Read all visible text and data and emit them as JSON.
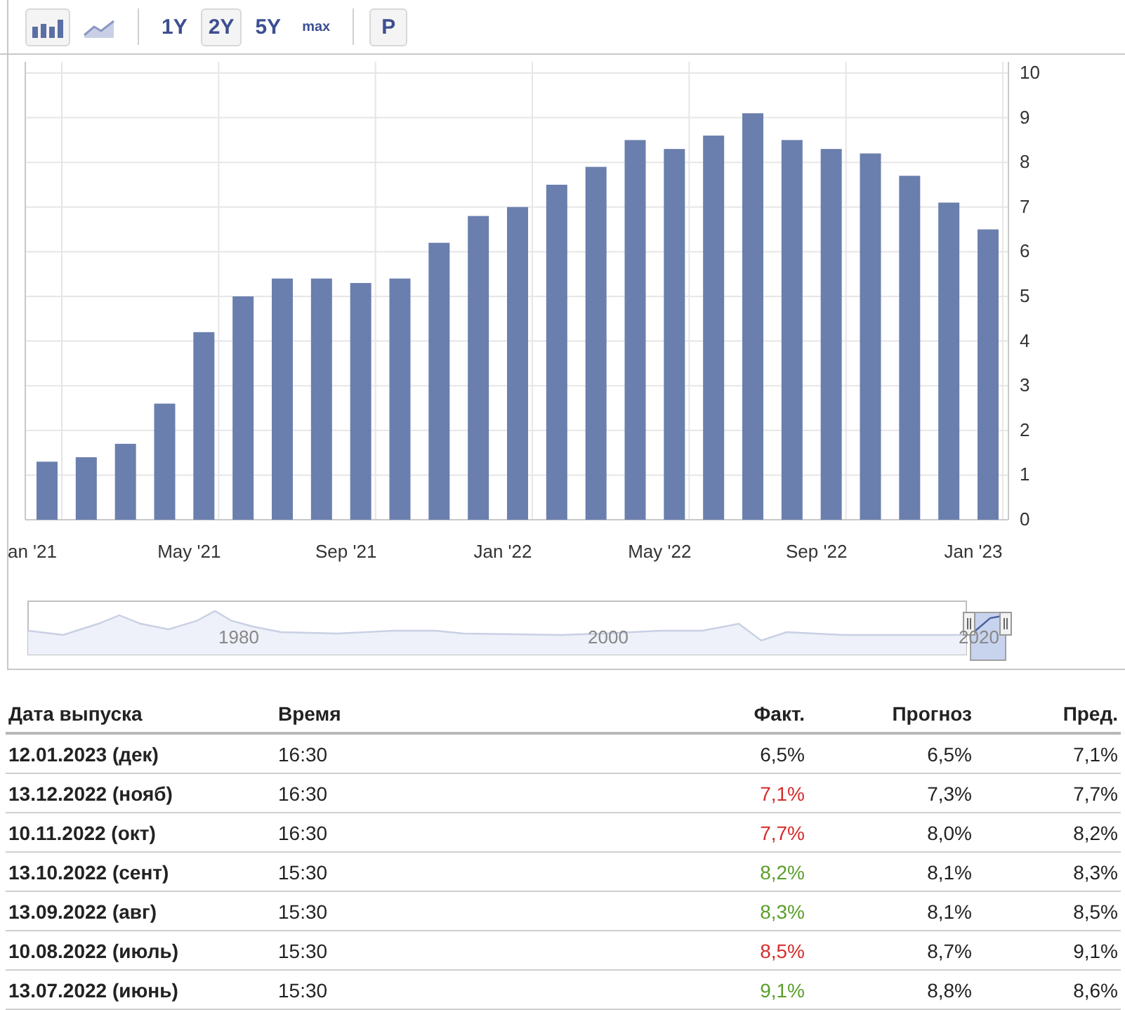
{
  "toolbar": {
    "chart_types": [
      {
        "kind": "bar",
        "selected": true
      },
      {
        "kind": "line",
        "selected": false
      }
    ],
    "ranges": [
      {
        "label": "1Y",
        "selected": false,
        "small": false
      },
      {
        "label": "2Y",
        "selected": true,
        "small": false
      },
      {
        "label": "5Y",
        "selected": false,
        "small": false
      },
      {
        "label": "max",
        "selected": false,
        "small": true
      }
    ],
    "buttons": [
      {
        "label": "P"
      }
    ]
  },
  "chart": {
    "chart_data": {
      "type": "bar",
      "categories": [
        "an '21",
        null,
        null,
        null,
        "May '21",
        null,
        null,
        null,
        "Sep '21",
        null,
        null,
        null,
        "Jan '22",
        null,
        null,
        null,
        "May '22",
        null,
        null,
        null,
        "Sep '22",
        null,
        null,
        null,
        "Jan '23"
      ],
      "series": [
        {
          "color": "#6b7fae",
          "values": [
            1.3,
            1.4,
            1.7,
            2.6,
            4.2,
            5.0,
            5.4,
            5.4,
            5.3,
            5.4,
            6.2,
            6.8,
            7.0,
            7.5,
            7.9,
            8.5,
            8.3,
            8.6,
            9.1,
            8.5,
            8.3,
            8.2,
            7.7,
            7.1,
            6.5
          ]
        }
      ],
      "grid": true,
      "ylim": [
        0,
        10
      ],
      "yticks": [
        0,
        1,
        2,
        3,
        4,
        5,
        6,
        7,
        8,
        9,
        10
      ]
    }
  },
  "navigator": {
    "labels": [
      "1980",
      "2000",
      "2020"
    ]
  },
  "table": {
    "columns": [
      "Дата выпуска",
      "Время",
      "Факт.",
      "Прогноз",
      "Пред."
    ],
    "rows": [
      {
        "date": "12.01.2023 (дек)",
        "time": "16:30",
        "actual": "6,5%",
        "color": "#222222",
        "forecast": "6,5%",
        "previous": "7,1%"
      },
      {
        "date": "13.12.2022 (нояб)",
        "time": "16:30",
        "actual": "7,1%",
        "color": "#d62b2b",
        "forecast": "7,3%",
        "previous": "7,7%"
      },
      {
        "date": "10.11.2022 (окт)",
        "time": "16:30",
        "actual": "7,7%",
        "color": "#d62b2b",
        "forecast": "8,0%",
        "previous": "8,2%"
      },
      {
        "date": "13.10.2022 (сент)",
        "time": "15:30",
        "actual": "8,2%",
        "color": "#5a9e2a",
        "forecast": "8,1%",
        "previous": "8,3%"
      },
      {
        "date": "13.09.2022 (авг)",
        "time": "15:30",
        "actual": "8,3%",
        "color": "#5a9e2a",
        "forecast": "8,1%",
        "previous": "8,5%"
      },
      {
        "date": "10.08.2022 (июль)",
        "time": "15:30",
        "actual": "8,5%",
        "color": "#d62b2b",
        "forecast": "8,7%",
        "previous": "9,1%"
      },
      {
        "date": "13.07.2022 (июнь)",
        "time": "15:30",
        "actual": "9,1%",
        "color": "#5a9e2a",
        "forecast": "8,8%",
        "previous": "8,6%"
      }
    ]
  }
}
